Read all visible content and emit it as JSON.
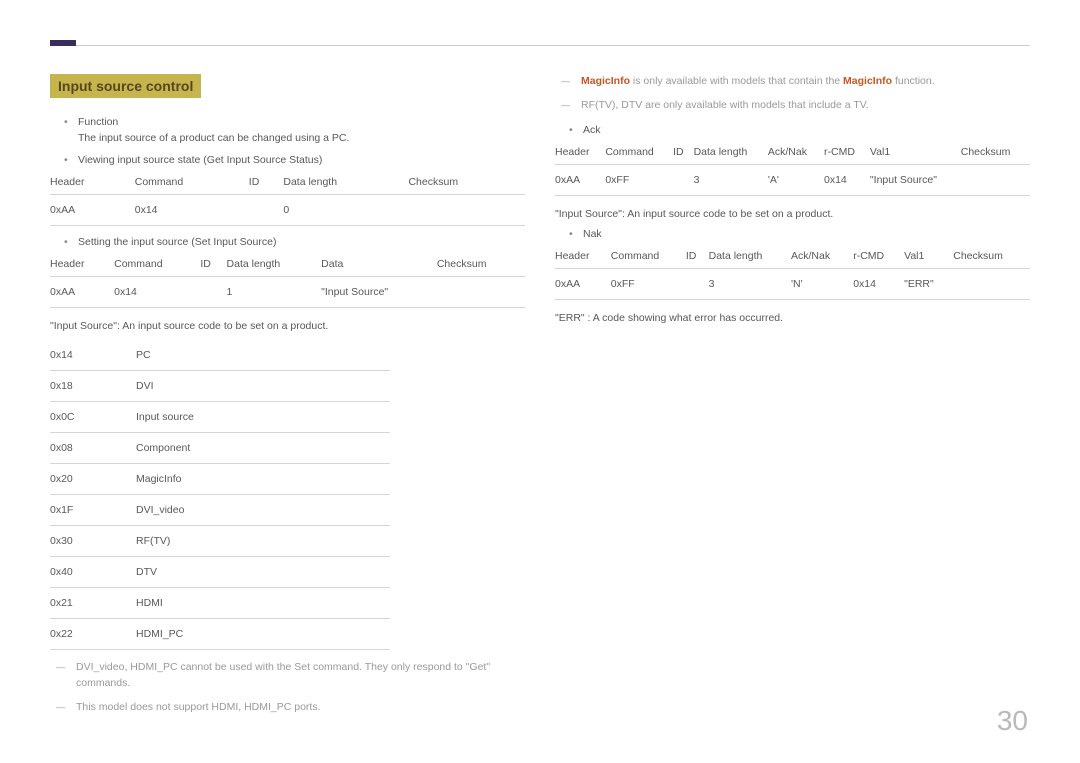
{
  "heading": "Input source control",
  "left": {
    "bullet_function": "Function",
    "function_desc": "The input source of a product can be changed using a PC.",
    "bullet_viewing": "Viewing input source state (Get Input Source Status)",
    "table_get": {
      "headers": {
        "h1": "Header",
        "h2": "Command",
        "h3": "ID",
        "h4": "Data length",
        "h5": "Checksum"
      },
      "row": {
        "c1": "0xAA",
        "c2": "0x14",
        "c3": "",
        "c4": "0",
        "c5": ""
      }
    },
    "bullet_setting": "Setting the input source (Set Input Source)",
    "table_set": {
      "headers": {
        "h1": "Header",
        "h2": "Command",
        "h3": "ID",
        "h4": "Data length",
        "h5": "Data",
        "h6": "Checksum"
      },
      "row": {
        "c1": "0xAA",
        "c2": "0x14",
        "c3": "",
        "c4": "1",
        "c5": "\"Input Source\"",
        "c6": ""
      }
    },
    "input_source_desc": "\"Input Source\": An input source code to be set on a product.",
    "codes": {
      "r1": {
        "c1": "0x14",
        "c2": "PC"
      },
      "r2": {
        "c1": "0x18",
        "c2": "DVI"
      },
      "r3": {
        "c1": "0x0C",
        "c2": "Input source"
      },
      "r4": {
        "c1": "0x08",
        "c2": "Component"
      },
      "r5": {
        "c1": "0x20",
        "c2": "MagicInfo"
      },
      "r6": {
        "c1": "0x1F",
        "c2": "DVI_video"
      },
      "r7": {
        "c1": "0x30",
        "c2": "RF(TV)"
      },
      "r8": {
        "c1": "0x40",
        "c2": "DTV"
      },
      "r9": {
        "c1": "0x21",
        "c2": "HDMI"
      },
      "r10": {
        "c1": "0x22",
        "c2": "HDMI_PC"
      }
    },
    "note1": "DVI_video, HDMI_PC cannot be used with the Set command. They only respond to \"Get\" commands.",
    "note2": "This model does not support HDMI, HDMI_PC ports."
  },
  "right": {
    "magicinfo_pre": "MagicInfo",
    "magicinfo_mid": " is only available with models that contain the ",
    "magicinfo_mid2": "MagicInfo",
    "magicinfo_post": " function.",
    "rftv_note": "RF(TV), DTV are only available with models that include a TV.",
    "bullet_ack": "Ack",
    "table_ack": {
      "headers": {
        "h1": "Header",
        "h2": "Command",
        "h3": "ID",
        "h4": "Data length",
        "h5": "Ack/Nak",
        "h6": "r-CMD",
        "h7": "Val1",
        "h8": "Checksum"
      },
      "row": {
        "c1": "0xAA",
        "c2": "0xFF",
        "c3": "",
        "c4": "3",
        "c5": "'A'",
        "c6": "0x14",
        "c7": "\"Input Source\"",
        "c8": ""
      }
    },
    "ack_desc": "\"Input Source\": An input source code to be set on a product.",
    "bullet_nak": "Nak",
    "table_nak": {
      "headers": {
        "h1": "Header",
        "h2": "Command",
        "h3": "ID",
        "h4": "Data length",
        "h5": "Ack/Nak",
        "h6": "r-CMD",
        "h7": "Val1",
        "h8": "Checksum"
      },
      "row": {
        "c1": "0xAA",
        "c2": "0xFF",
        "c3": "",
        "c4": "3",
        "c5": "'N'",
        "c6": "0x14",
        "c7": "\"ERR\"",
        "c8": ""
      }
    },
    "nak_desc": "\"ERR\" : A code showing what error has occurred."
  },
  "page_number": "30"
}
